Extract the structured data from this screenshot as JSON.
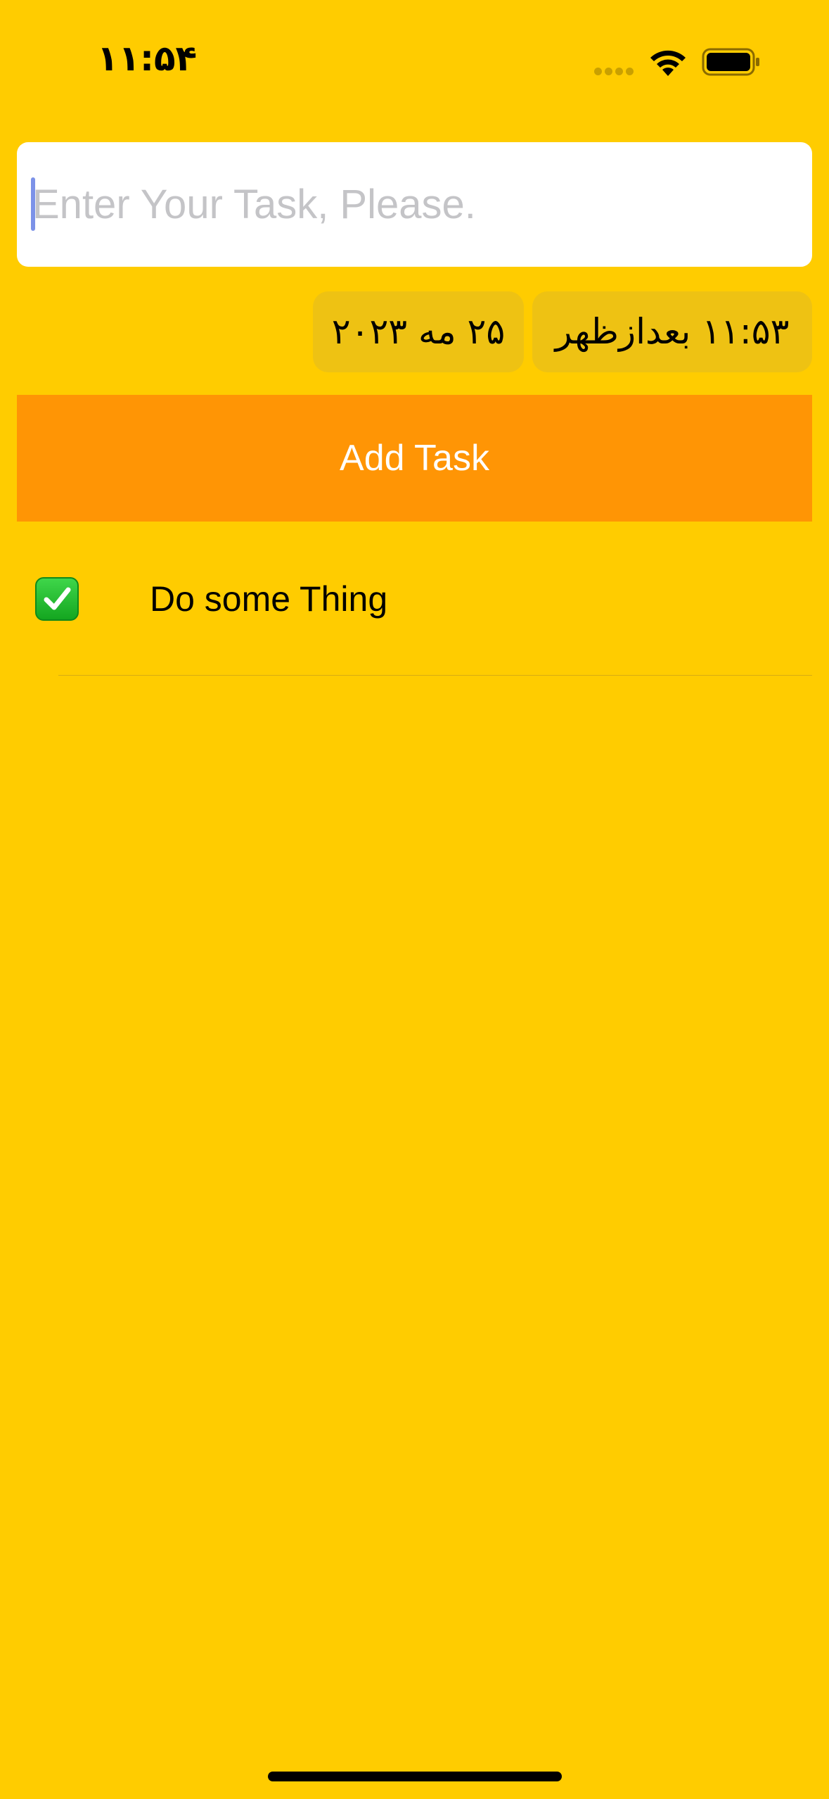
{
  "status_bar": {
    "time": "۱۱:۵۴",
    "icons": [
      "signal-dots-icon",
      "wifi-icon",
      "battery-icon"
    ]
  },
  "task_input": {
    "value": "",
    "placeholder": "Enter Your Task, Please."
  },
  "date_picker": {
    "date": "۲۵ مه ۲۰۲۳",
    "time": "۱۱:۵۳ بعدازظهر"
  },
  "add_task_button": {
    "label": "Add Task"
  },
  "tasks": [
    {
      "title": "Do some Thing",
      "status_icon": "check-mark-icon",
      "done": true
    }
  ],
  "colors": {
    "background": "#FFCC00",
    "button": "#FF9505",
    "pill": "#EEC213",
    "check": "#14A620"
  }
}
